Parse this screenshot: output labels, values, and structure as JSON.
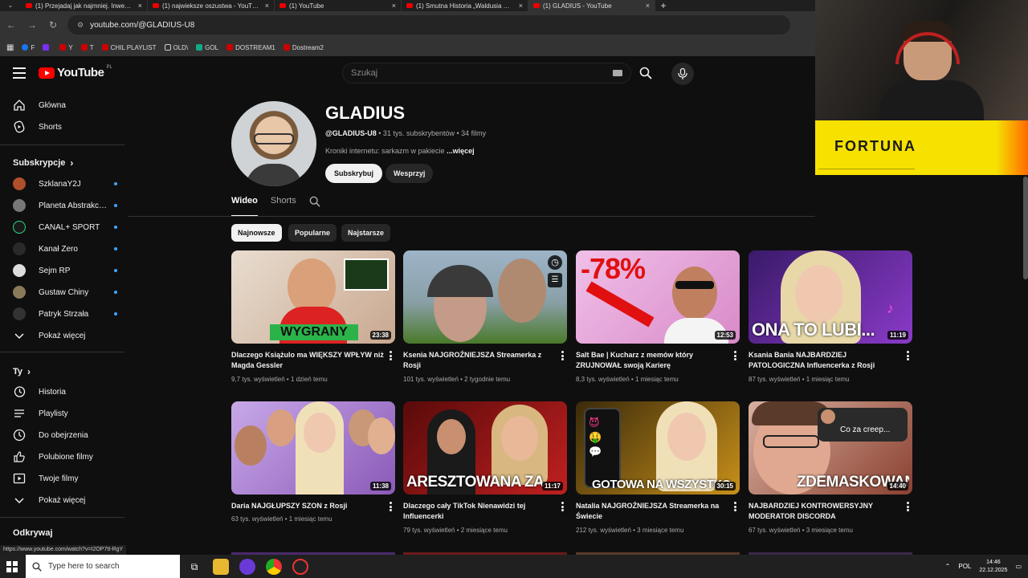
{
  "browser": {
    "tabs": [
      {
        "title": "(1) Przejadaj jak najmniej. Inwe…",
        "active": false
      },
      {
        "title": "(1) najwieksze oszustwa - YouT…",
        "active": false
      },
      {
        "title": "(1) YouTube",
        "active": false
      },
      {
        "title": "(1) Smutna Historia „Waldusia …",
        "active": false
      },
      {
        "title": "(1) GLADIUS - YouTube",
        "active": true
      }
    ],
    "url": "youtube.com/@GLADIUS-U8",
    "bookmarks": [
      "F",
      "",
      "Y",
      "T",
      "CHIL PLAYLIST",
      "OLD\\",
      "GOL",
      "DOSTREAM1",
      "Dostream2"
    ],
    "status_url": "https://www.youtube.com/watch?v=I2OP7tt-RgY"
  },
  "youtube": {
    "logo_text": "YouTube",
    "country": "PL",
    "search_placeholder": "Szukaj",
    "sidebar": {
      "main": [
        {
          "label": "Główna",
          "icon": "home-icon"
        },
        {
          "label": "Shorts",
          "icon": "shorts-icon"
        }
      ],
      "subs_header": "Subskrypcje",
      "subs": [
        {
          "label": "SzklanaY2J",
          "color": "#b0502a"
        },
        {
          "label": "Planeta Abstrakc…",
          "color": "#777777"
        },
        {
          "label": "CANAL+ SPORT",
          "color": "#1a1a1a"
        },
        {
          "label": "Kanał Zero",
          "color": "#2a2a2a"
        },
        {
          "label": "Sejm RP",
          "color": "#dddddd"
        },
        {
          "label": "Gustaw Chiny",
          "color": "#8a7a5a"
        },
        {
          "label": "Patryk Strzała",
          "color": "#333333"
        }
      ],
      "show_more": "Pokaż więcej",
      "you_header": "Ty",
      "you": [
        {
          "label": "Historia",
          "icon": "history-icon"
        },
        {
          "label": "Playlisty",
          "icon": "playlist-icon"
        },
        {
          "label": "Do obejrzenia",
          "icon": "watch-later-icon"
        },
        {
          "label": "Polubione filmy",
          "icon": "like-icon"
        },
        {
          "label": "Twoje filmy",
          "icon": "your-videos-icon"
        }
      ],
      "show_more2": "Pokaż więcej",
      "discover_header": "Odkrywaj"
    },
    "channel": {
      "name": "GLADIUS",
      "handle": "@GLADIUS-U8",
      "meta_rest": " • 31 tys. subskrybentów • 34 filmy",
      "description": "Kroniki internetu: sarkazm w pakiecie ",
      "more": "...więcej",
      "subscribe": "Subskrybuj",
      "support": "Wesprzyj",
      "tabs": [
        "Wideo",
        "Shorts"
      ],
      "chips": [
        "Najnowsze",
        "Popularne",
        "Najstarsze"
      ]
    },
    "videos": [
      {
        "title": "Dlaczego Książulo ma WIĘKSZY WPŁYW niż Magda Gessler",
        "meta": "9,7 tys. wyświetleń • 1 dzień temu",
        "duration": "23:38",
        "overlay": "WYGRANY",
        "bg": "#c9a890"
      },
      {
        "title": "Ksenia NAJGROŹNIEJSZA Streamerka z Rosji",
        "meta": "101 tys. wyświetleń • 2 tygodnie temu",
        "duration": "",
        "overlay": "",
        "bg": "#9db4c8"
      },
      {
        "title": "Salt Bae | Kucharz z memów który ZRUJNOWAŁ swoją Karierę",
        "meta": "8,3 tys. wyświetleń • 1 miesiąc temu",
        "duration": "12:53",
        "overlay": "-78%",
        "bg": "#e8a0d0"
      },
      {
        "title": "Ksania Bania NAJBARDZIEJ PATOLOGICZNA Influencerka z Rosji",
        "meta": "87 tys. wyświetleń • 1 miesiąc temu",
        "duration": "11:19",
        "overlay": "ONA TO LUBI...",
        "bg": "#6a2a9a"
      },
      {
        "title": "Daria NAJGŁUPSZY SZON z Rosji",
        "meta": "63 tys. wyświetleń • 1 miesiąc temu",
        "duration": "11:38",
        "overlay": "",
        "bg": "#b47ad8"
      },
      {
        "title": "Dlaczego cały TikTok Nienawidzi tej Influencerki",
        "meta": "79 tys. wyświetleń • 2 miesiące temu",
        "duration": "11:17",
        "overlay": "ARESZTOWANA ZA ...",
        "bg": "#8a1a1a"
      },
      {
        "title": "Natalia NAJGROŹNIEJSZA Streamerka na Świecie",
        "meta": "212 tys. wyświetleń • 3 miesiące temu",
        "duration": "30:15",
        "overlay": "GOTOWA NA WSZYSTKO",
        "bg": "#7a5a1a"
      },
      {
        "title": "NAJBARDZIEJ KONTROWERSYJNY MODERATOR DISCORDA",
        "meta": "67 tys. wyświetleń • 3 miesiące temu",
        "duration": "14:40",
        "overlay": "ZDEMASKOWANY",
        "bg": "#c07060",
        "bubble": "Co za creep..."
      }
    ]
  },
  "overlay": {
    "sponsor": "FORTUNA"
  },
  "taskbar": {
    "search_placeholder": "Type here to search",
    "lang": "POL",
    "time": "14:46",
    "date": "22.12.2025"
  }
}
